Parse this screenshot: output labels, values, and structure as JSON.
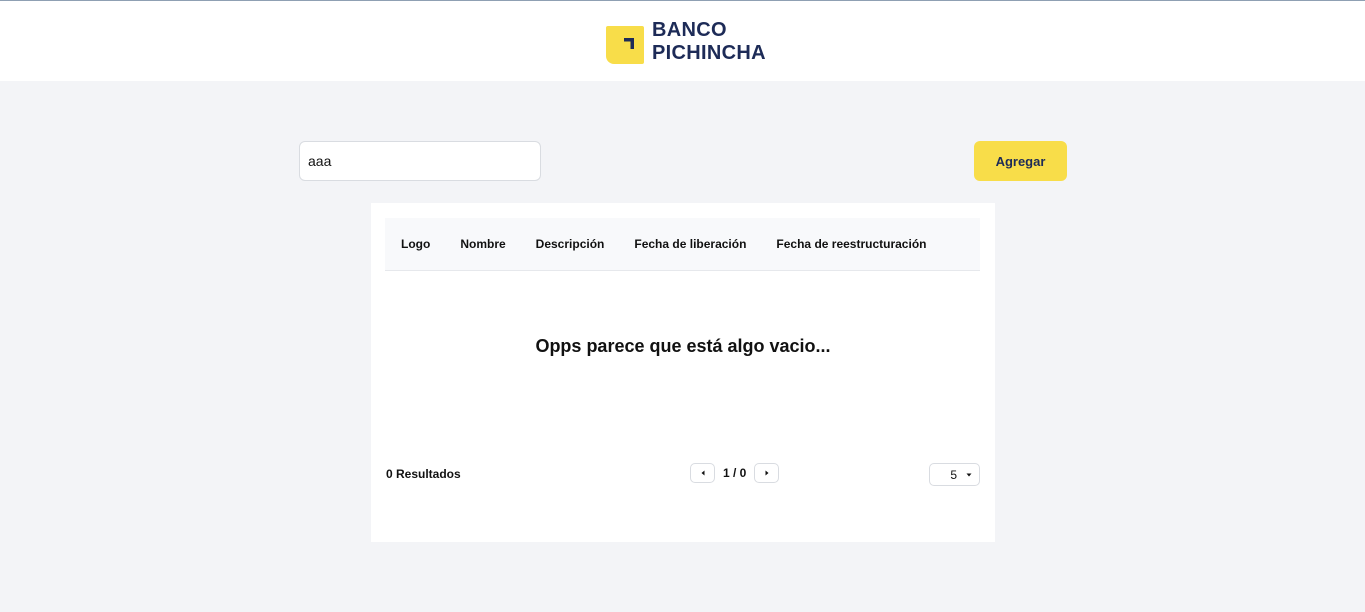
{
  "header": {
    "brand_line1": "BANCO",
    "brand_line2": "PICHINCHA",
    "logo_icon": "banco-pichincha-logo-icon",
    "brand_color": "#1d2b57",
    "accent_color": "#f8dd49"
  },
  "toolbar": {
    "search_value": "aaa",
    "add_label": "Agregar"
  },
  "table": {
    "columns": [
      "Logo",
      "Nombre",
      "Descripción",
      "Fecha de liberación",
      "Fecha de reestructuración"
    ],
    "rows": [],
    "empty_message": "Opps parece que está algo vacio..."
  },
  "footer": {
    "results_label": "0 Resultados",
    "page_indicator": "1 / 0",
    "page_size": "5"
  }
}
